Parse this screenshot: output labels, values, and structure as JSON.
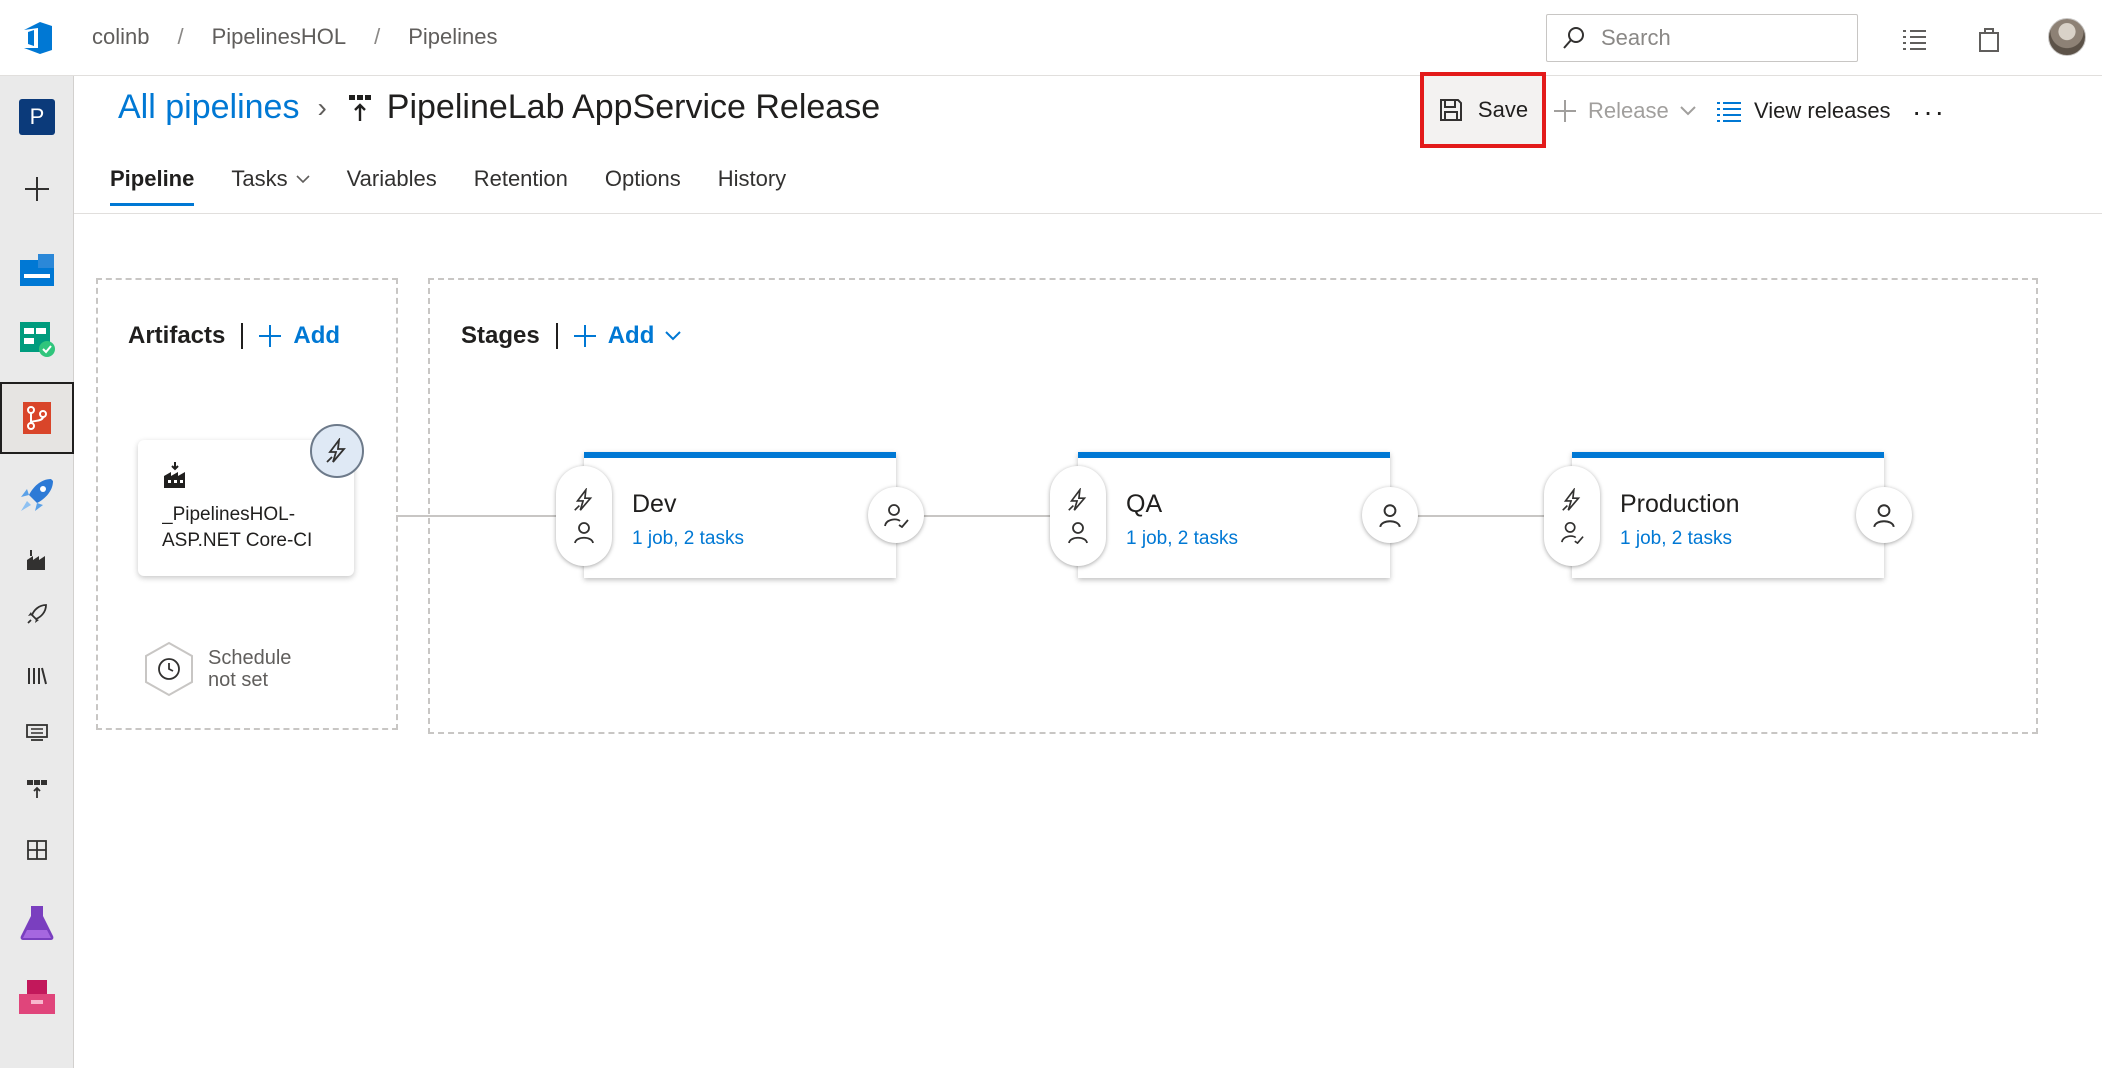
{
  "breadcrumb": [
    "colinb",
    "PipelinesHOL",
    "Pipelines"
  ],
  "search": {
    "placeholder": "Search"
  },
  "leftnav": {
    "project_initial": "P"
  },
  "header": {
    "all_pipelines": "All pipelines",
    "title": "PipelineLab AppService Release",
    "save_label": "Save",
    "release_label": "Release",
    "view_releases_label": "View releases",
    "more_label": "···"
  },
  "tabs": [
    {
      "label": "Pipeline",
      "active": true
    },
    {
      "label": "Tasks",
      "dropdown": true
    },
    {
      "label": "Variables"
    },
    {
      "label": "Retention"
    },
    {
      "label": "Options"
    },
    {
      "label": "History"
    }
  ],
  "artifacts": {
    "heading": "Artifacts",
    "add_label": "Add",
    "item": {
      "line1": "_PipelinesHOL-",
      "line2": "ASP.NET Core-CI"
    },
    "schedule_line1": "Schedule",
    "schedule_line2": "not set"
  },
  "stages": {
    "heading": "Stages",
    "add_label": "Add",
    "items": [
      {
        "name": "Dev",
        "summary": "1 job, 2 tasks"
      },
      {
        "name": "QA",
        "summary": "1 job, 2 tasks"
      },
      {
        "name": "Production",
        "summary": "1 job, 2 tasks"
      }
    ]
  },
  "colors": {
    "accent": "#0078d4",
    "highlight": "#e31b1b"
  }
}
